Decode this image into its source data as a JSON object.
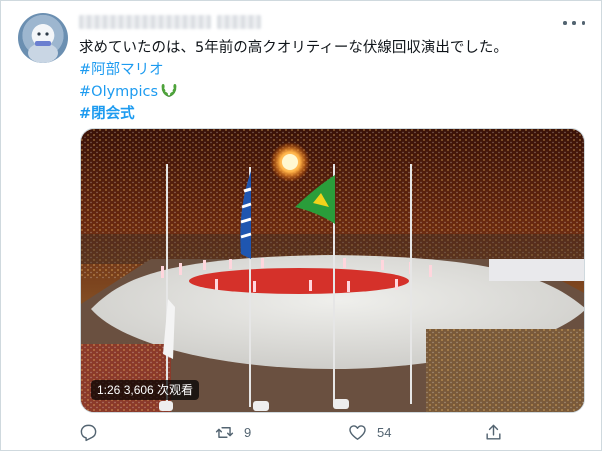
{
  "tweet": {
    "author_redacted": true,
    "text_line1": "求めていたのは、5年前の高クオリティーな伏線回収演出でした。",
    "hashtags": [
      {
        "label": "#阿部マリオ",
        "bold": false
      },
      {
        "label": "#Olympics",
        "bold": false,
        "emoji": "laurel-wreath-icon"
      },
      {
        "label": "#閉会式",
        "bold": true
      }
    ]
  },
  "media": {
    "duration": "1:26",
    "views": "3,606 次观看",
    "badge_text": "1:26  3,606 次观看"
  },
  "actions": {
    "reply": {
      "icon": "reply-icon",
      "count": ""
    },
    "retweet": {
      "icon": "retweet-icon",
      "count": "9"
    },
    "like": {
      "icon": "heart-icon",
      "count": "54"
    },
    "share": {
      "icon": "share-icon",
      "count": ""
    }
  },
  "colors": {
    "link": "#1d9bf0",
    "icon_gray": "#536471",
    "border": "#cfd9de"
  }
}
